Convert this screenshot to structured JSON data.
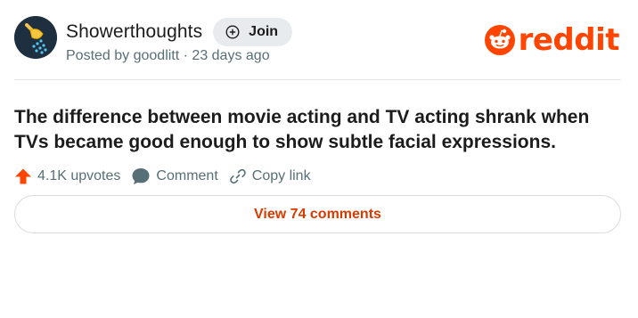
{
  "post": {
    "community": "Showerthoughts",
    "join_label": "Join",
    "posted_by": "Posted by goodlitt · 23 days ago",
    "title": "The difference between movie acting and TV acting shrank when TVs became good enough to show subtle facial expressions.",
    "upvotes": "4.1K upvotes",
    "comment_label": "Comment",
    "copy_link_label": "Copy link",
    "view_comments_label": "View 74 comments"
  },
  "brand": {
    "wordmark": "reddit",
    "color": "#ff4500"
  },
  "icons": {
    "avatar": "shower-head-icon",
    "join": "plus-circle-icon",
    "upvote": "upvote-arrow-icon",
    "comment": "speech-bubble-icon",
    "link": "chain-link-icon",
    "logo": "reddit-snoo-icon"
  },
  "colors": {
    "accent": "#d93a00",
    "upvote": "#ff4500",
    "meta_text": "#576f76",
    "join_bg": "#e8ebee"
  }
}
